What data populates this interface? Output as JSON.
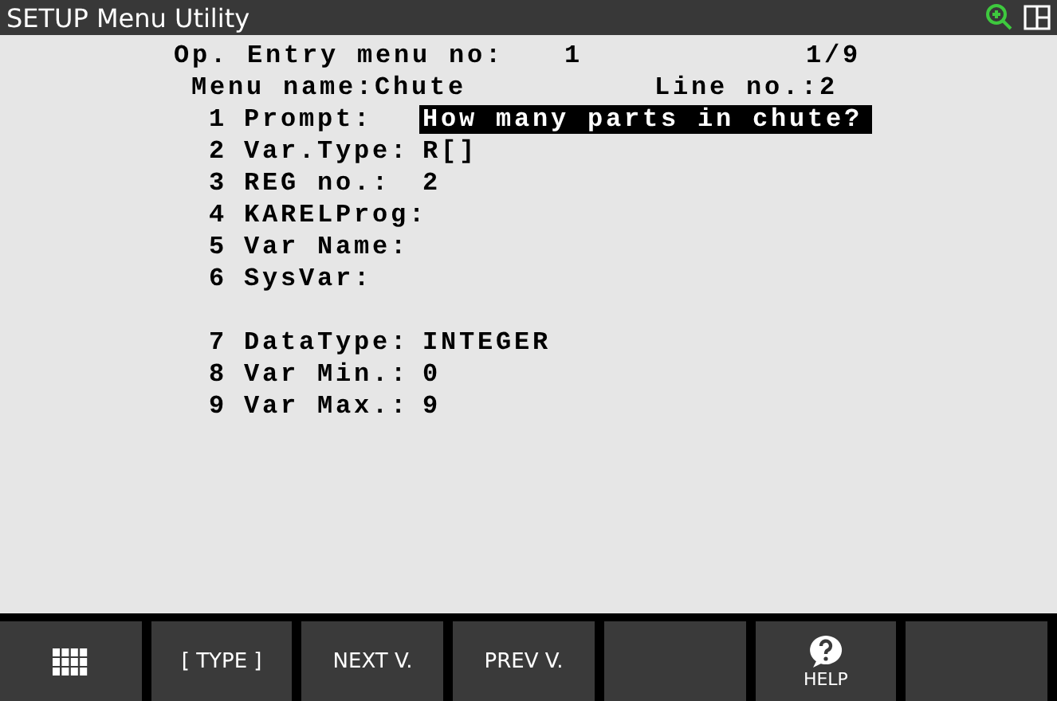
{
  "window": {
    "title": "SETUP Menu Utility"
  },
  "header": {
    "entry_label": "Op. Entry menu no:",
    "entry_value": "1",
    "page": "1/9",
    "menu_name": "Menu name:Chute",
    "line_no": "Line no.:2"
  },
  "items": [
    {
      "number": "1",
      "label": "Prompt:",
      "value": "How many parts in chute?",
      "selected": true
    },
    {
      "number": "2",
      "label": "Var.Type:",
      "value": "R[]",
      "selected": false
    },
    {
      "number": "3",
      "label": "REG no.:",
      "value": "2",
      "selected": false
    },
    {
      "number": "4",
      "label": "KARELProg:",
      "selected": false
    },
    {
      "number": "5",
      "label": "Var Name:",
      "selected": false
    },
    {
      "number": "6",
      "label": "SysVar:",
      "selected": false
    }
  ],
  "data_items": [
    {
      "number": "7",
      "label": "DataType:",
      "value": "INTEGER",
      "selected": false
    },
    {
      "number": "8",
      "label": "Var Min.:",
      "value": "0",
      "selected": false
    },
    {
      "number": "9",
      "label": "Var Max.:",
      "value": "9",
      "selected": false
    }
  ],
  "function_keys": [
    {
      "kind": "menu"
    },
    {
      "kind": "text",
      "label": "[ TYPE ]"
    },
    {
      "kind": "text",
      "label": "NEXT V."
    },
    {
      "kind": "text",
      "label": "PREV V."
    },
    {
      "kind": "empty"
    },
    {
      "kind": "help",
      "label": "HELP"
    },
    {
      "kind": "empty"
    }
  ]
}
